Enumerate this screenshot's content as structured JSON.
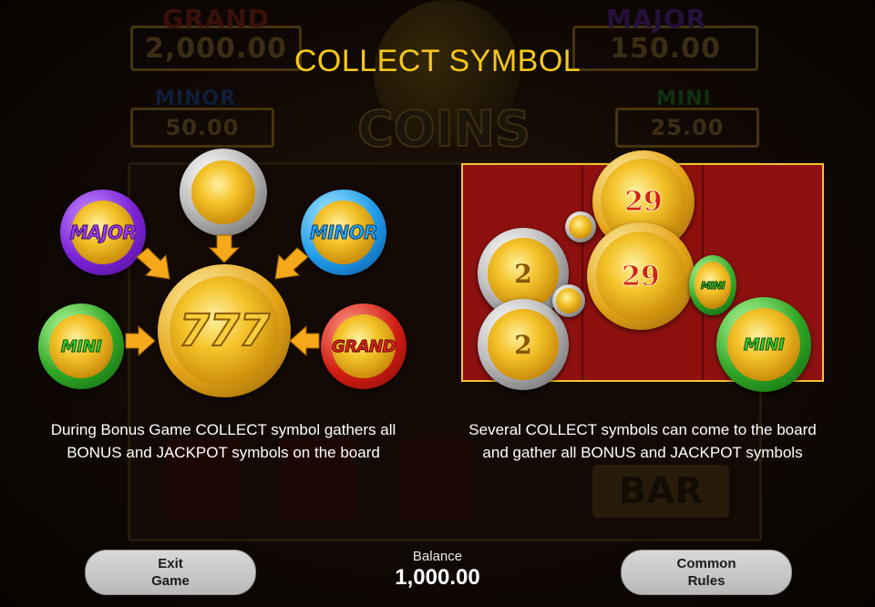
{
  "background": {
    "jackpots": [
      {
        "label": "GRAND",
        "value": "2,000.00"
      },
      {
        "label": "MAJOR",
        "value": "150.00"
      },
      {
        "label": "MINOR",
        "value": "50.00"
      },
      {
        "label": "MINI",
        "value": "25.00"
      }
    ],
    "game_title": "COINS",
    "bar_symbol": "BAR"
  },
  "title": "COLLECT SYMBOL",
  "left_illustration": {
    "coins": {
      "major": "MAJOR",
      "minor": "MINOR",
      "mini": "MINI",
      "grand": "GRAND",
      "collect": "777"
    }
  },
  "right_illustration": {
    "coin_values": {
      "collect_top": "29",
      "collect_mid": "29",
      "bonus_a": "2",
      "bonus_b": "2",
      "mini_small": "MINI",
      "mini_big": "MINI"
    }
  },
  "descriptions": {
    "left": "During Bonus Game COLLECT symbol gathers all BONUS and JACKPOT symbols on the board",
    "right": "Several COLLECT symbols can come to the board and gather all BONUS and JACKPOT symbols"
  },
  "footer": {
    "exit_line1": "Exit",
    "exit_line2": "Game",
    "balance_label": "Balance",
    "balance_value": "1,000.00",
    "rules_line1": "Common",
    "rules_line2": "Rules"
  },
  "colors": {
    "title": "#f6c71b",
    "major": "#9a3cf0",
    "minor": "#2aa4ef",
    "mini": "#3ccf2b",
    "grand": "#e3261b",
    "panel_border": "#f2c232"
  }
}
